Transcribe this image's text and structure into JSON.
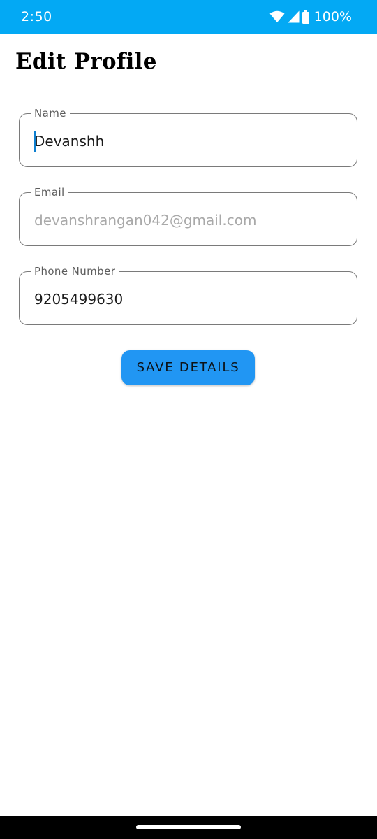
{
  "status_bar": {
    "time": "2:50",
    "battery": "100%",
    "background_color": "#03a9f4",
    "icons": [
      "wifi-icon",
      "cell-signal-icon",
      "battery-icon"
    ]
  },
  "page": {
    "title": "Edit Profile"
  },
  "form": {
    "name": {
      "label": "Name",
      "value": "Devanshh"
    },
    "email": {
      "label": "Email",
      "value": "devanshrangan042@gmail.com"
    },
    "phone": {
      "label": "Phone Number",
      "value": "9205499630"
    }
  },
  "actions": {
    "save_label": "SAVE DETAILS",
    "save_color": "#2196f3"
  }
}
